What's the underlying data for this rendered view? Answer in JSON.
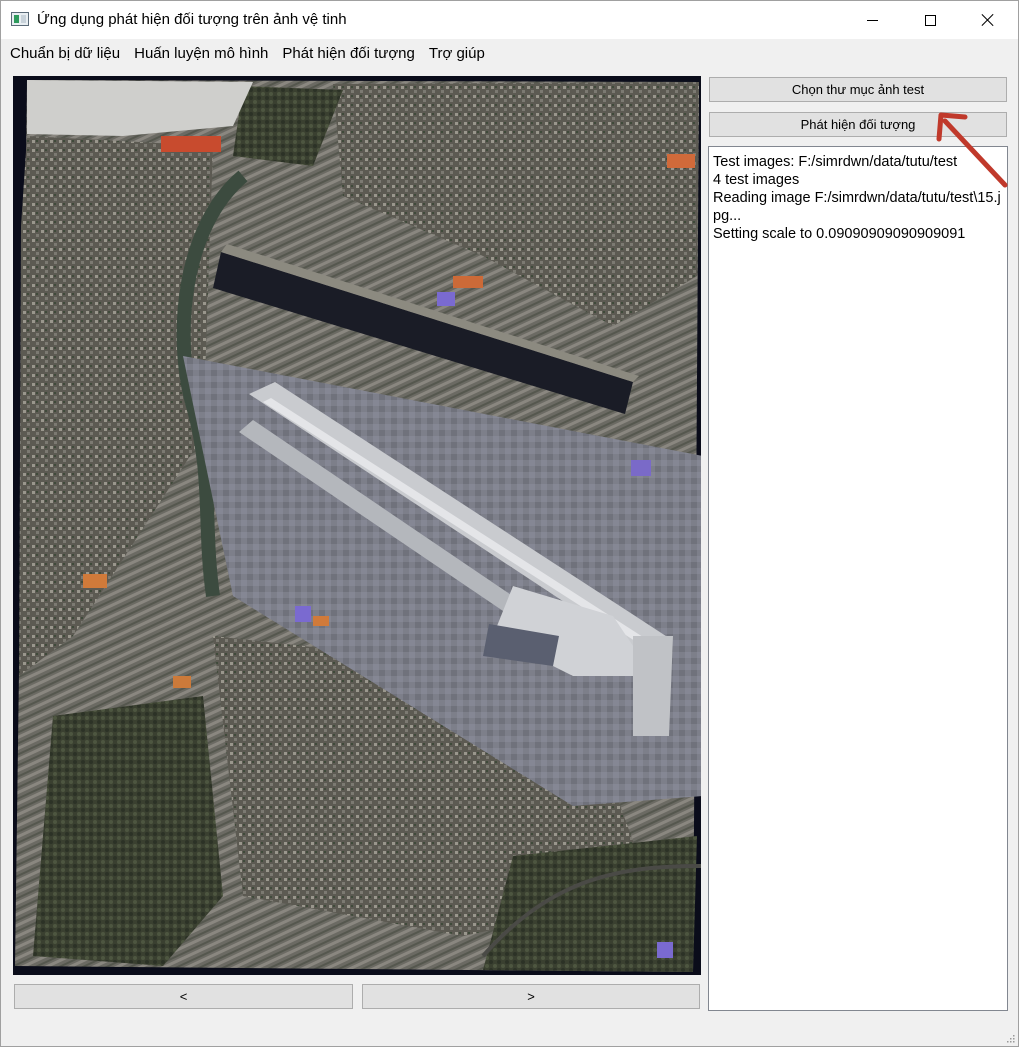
{
  "window": {
    "title": "Ứng dụng phát hiện đối tượng trên ảnh vệ tinh",
    "icon": "app-icon"
  },
  "menu": {
    "items": [
      {
        "label": "Chuẩn bị dữ liệu"
      },
      {
        "label": "Huấn luyện mô hình"
      },
      {
        "label": "Phát hiện đối tượng"
      },
      {
        "label": "Trợ giúp"
      }
    ]
  },
  "viewer": {
    "image_subject": "satellite-image-airport"
  },
  "navigation": {
    "prev_label": "<",
    "next_label": ">"
  },
  "actions": {
    "choose_folder_label": "Chọn thư mục ảnh test",
    "detect_label": "Phát hiện đối tượng"
  },
  "log": {
    "lines": [
      "Test images: F:/simrdwn/data/tutu/test",
      "4 test images",
      "Reading image F:/simrdwn/data/tutu/test\\15.jpg...",
      "Setting scale to 0.09090909090909091"
    ]
  },
  "colors": {
    "annotation_arrow": "#c0392b",
    "window_bg": "#f0f0f0",
    "button_bg": "#e1e1e1"
  }
}
